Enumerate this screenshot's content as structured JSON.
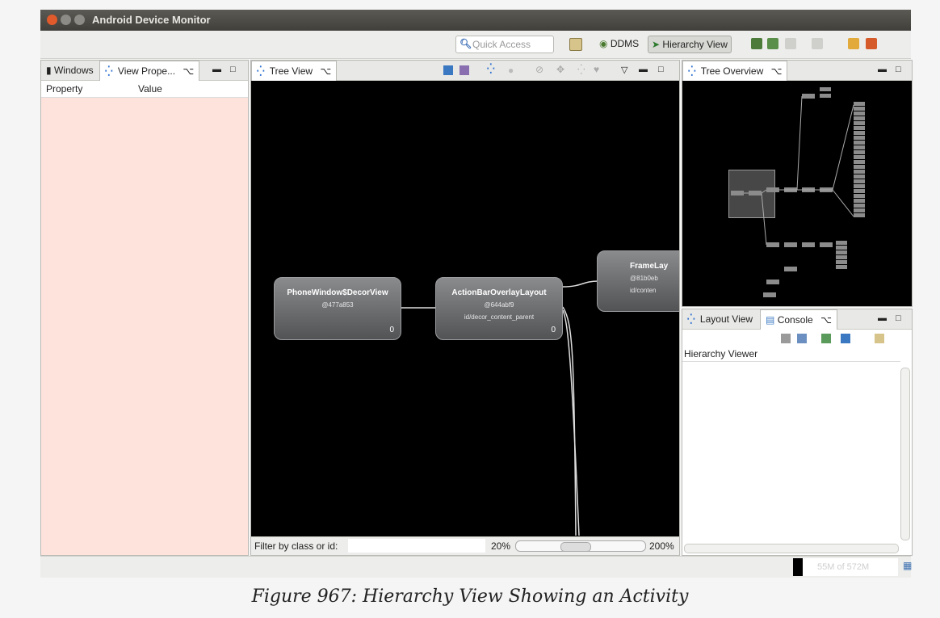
{
  "window": {
    "title": "Android Device Monitor"
  },
  "toolbar": {
    "quick_access_placeholder": "Quick Access",
    "perspective_ddms": "DDMS",
    "perspective_hierarchy": "Hierarchy View"
  },
  "left_pane": {
    "tabs": [
      {
        "label": "Windows"
      },
      {
        "label": "View Prope..."
      }
    ],
    "columns": [
      "Property",
      "Value"
    ]
  },
  "tree_view": {
    "tab_label": "Tree View",
    "nodes": [
      {
        "name": "PhoneWindow$DecorView",
        "hash": "@477a853",
        "id": "",
        "count": "0"
      },
      {
        "name": "ActionBarOverlayLayout",
        "hash": "@644abf9",
        "id": "id/decor_content_parent",
        "count": "0"
      },
      {
        "name": "FrameLay",
        "hash": "@81b0eb",
        "id": "id/conten",
        "count": ""
      }
    ],
    "filter_label": "Filter by class or id:",
    "zoom_min": "20%",
    "zoom_max": "200%"
  },
  "tree_overview": {
    "tab_label": "Tree Overview"
  },
  "bottom_right": {
    "tabs": [
      {
        "label": "Layout View"
      },
      {
        "label": "Console"
      }
    ],
    "console_title": "Hierarchy Viewer"
  },
  "status": {
    "memory": "55M of 572M"
  },
  "caption": "Figure 967: Hierarchy View Showing an Activity"
}
